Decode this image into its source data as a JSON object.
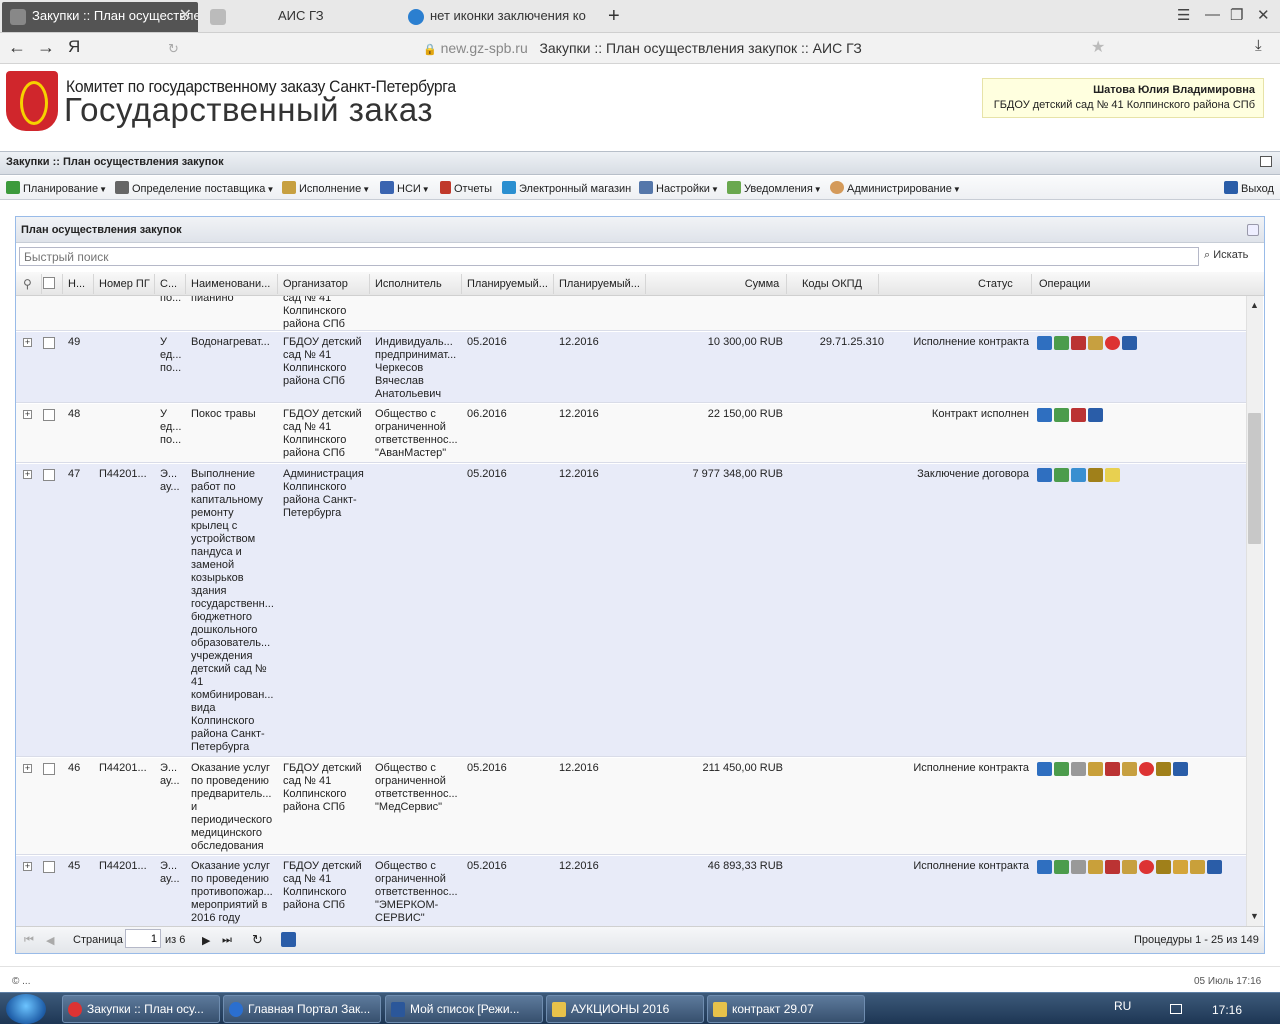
{
  "browser": {
    "tabs": [
      {
        "title": "Закупки :: План осуществле",
        "active": true
      },
      {
        "title": "АИС ГЗ",
        "active": false
      },
      {
        "title": "нет иконки заключения ко",
        "active": false
      }
    ],
    "new_tab": "+",
    "url_host": "new.gz-spb.ru",
    "url_title": "Закупки :: План осуществления закупок :: АИС ГЗ"
  },
  "header": {
    "org_line": "Комитет по государственному заказу Санкт-Петербурга",
    "site_name": "Государственный заказ",
    "user_name": "Шатова Юлия Владимировна",
    "user_org": "ГБДОУ детский сад № 41 Колпинского района СПб"
  },
  "app": {
    "title": "Закупки :: План осуществления закупок",
    "menu": [
      {
        "label": "Планирование",
        "dd": true,
        "icon_color": "#3c9a3c"
      },
      {
        "label": "Определение поставщика",
        "dd": true,
        "icon_color": "#666666"
      },
      {
        "label": "Исполнение",
        "dd": true,
        "icon_color": "#c7a040"
      },
      {
        "label": "НСИ",
        "dd": true,
        "icon_color": "#3a64b0"
      },
      {
        "label": "Отчеты",
        "dd": false,
        "icon_color": "#c0392b"
      },
      {
        "label": "Электронный магазин",
        "dd": false,
        "icon_color": "#2b8fd0"
      },
      {
        "label": "Настройки",
        "dd": true,
        "icon_color": "#5577aa"
      },
      {
        "label": "Уведомления",
        "dd": true,
        "icon_color": "#6aa84f"
      },
      {
        "label": "Администрирование",
        "dd": true,
        "icon_color": "#d49a5a"
      }
    ],
    "logout": "Выход"
  },
  "panel": {
    "title": "План осуществления закупок",
    "search_placeholder": "Быстрый поиск",
    "search_button": "Искать",
    "columns": [
      "Н...",
      "Номер ПГ",
      "С...",
      "Наименовани...",
      "Организатор",
      "Исполнитель",
      "Планируемый...",
      "Планируемый...",
      "Сумма",
      "Коды ОКПД",
      "Статус",
      "Операции"
    ],
    "rows": [
      {
        "n": "",
        "pg": "",
        "s": "по...",
        "name": "пианино",
        "org": "сад № 41\nКолпинского\nрайона СПб",
        "exec": "",
        "p1": "",
        "p2": "",
        "sum": "",
        "okpd": "",
        "status": "",
        "ops": []
      },
      {
        "n": "49",
        "pg": "",
        "s": "У\nед...\nпо...",
        "name": "Водонагреват...",
        "org": "ГБДОУ детский\nсад № 41\nКолпинского\nрайона СПб",
        "exec": "Индивидуаль...\nпредпринимат...\nЧеркесов\nВячеслав\nАнатольевич",
        "p1": "05.2016",
        "p2": "12.2016",
        "sum": "10 300,00 RUB",
        "okpd": "29.71.25.310",
        "status": "Исполнение контракта",
        "ops": [
          "#2f6fc0",
          "#4c9c4c",
          "#b33",
          "#c7a040",
          "#d33",
          "#2a5da8"
        ]
      },
      {
        "n": "48",
        "pg": "",
        "s": "У\nед...\nпо...",
        "name": "Покос травы",
        "org": "ГБДОУ детский\nсад № 41\nКолпинского\nрайона СПб",
        "exec": "Общество с\nограниченной\nответственнос...\n\"АванМастер\"",
        "p1": "06.2016",
        "p2": "12.2016",
        "sum": "22 150,00 RUB",
        "okpd": "",
        "status": "Контракт исполнен",
        "ops": [
          "#2f6fc0",
          "#4c9c4c",
          "#b33",
          "#2a5da8"
        ]
      },
      {
        "n": "47",
        "pg": "П44201...",
        "s": "Э...\nау...",
        "name": "Выполнение\nработ по\nкапитальному\nремонту\nкрылец с\nустройством\nпандуса и\nзаменой\nкозырьков\nздания\nгосударственн...\nбюджетного\nдошкольного\nобразователь...\nучреждения\nдетский сад №\n41\nкомбинирован...\nвида\nКолпинского\nрайона Санкт-\nПетербурга",
        "org": "Администрация\nКолпинского\nрайона Санкт-\nПетербурга",
        "exec": "",
        "p1": "05.2016",
        "p2": "12.2016",
        "sum": "7 977 348,00 RUB",
        "okpd": "",
        "status": "Заключение договора",
        "ops": [
          "#2f6fc0",
          "#4c9c4c",
          "#3a8fd0",
          "#a0801a",
          "#e8d050"
        ]
      },
      {
        "n": "46",
        "pg": "П44201...",
        "s": "Э...\nау...",
        "name": "Оказание услуг\nпо проведению\nпредваритель...\nи\nпериодического\nмедицинского\nобследования",
        "org": "ГБДОУ детский\nсад № 41\nКолпинского\nрайона СПб",
        "exec": "Общество с\nограниченной\nответственнос...\n\"МедСервис\"",
        "p1": "05.2016",
        "p2": "12.2016",
        "sum": "211 450,00 RUB",
        "okpd": "",
        "status": "Исполнение контракта",
        "ops": [
          "#2f6fc0",
          "#4c9c4c",
          "#999",
          "#c9a03a",
          "#b33",
          "#c7a040",
          "#d33",
          "#a0801a",
          "#2a5da8"
        ]
      },
      {
        "n": "45",
        "pg": "П44201...",
        "s": "Э...\nау...",
        "name": "Оказание услуг\nпо проведению\nпротивопожар...\nмероприятий в\n2016 году",
        "org": "ГБДОУ детский\nсад № 41\nКолпинского\nрайона СПб",
        "exec": "Общество с\nограниченной\nответственнос...\n\"ЭМЕРКОМ-\nСЕРВИС\"",
        "p1": "05.2016",
        "p2": "12.2016",
        "sum": "46 893,33 RUB",
        "okpd": "",
        "status": "Исполнение контракта",
        "ops": [
          "#2f6fc0",
          "#4c9c4c",
          "#999",
          "#c9a03a",
          "#b33",
          "#c7a040",
          "#d33",
          "#a0801a",
          "#d4a53a",
          "#c9a03a",
          "#2a5da8"
        ]
      }
    ],
    "pager": {
      "page_label": "Страница",
      "page": "1",
      "of_label": "из 6",
      "summary": "Процедуры 1 - 25 из 149"
    }
  },
  "footer": {
    "left": "© ...",
    "right": "05 Июль 17:16"
  },
  "taskbar": {
    "tasks": [
      {
        "label": "Закупки :: План осу...",
        "icon_color": "#d33"
      },
      {
        "label": "Главная Портал Зак...",
        "icon_color": "#2b6fd0"
      },
      {
        "label": "Мой список [Режи...",
        "icon_color": "#2b579a"
      },
      {
        "label": "АУКЦИОНЫ 2016",
        "icon_color": "#e8c24a"
      },
      {
        "label": "контракт 29.07",
        "icon_color": "#e8c24a"
      }
    ],
    "lang": "RU",
    "clock": "17:16"
  }
}
